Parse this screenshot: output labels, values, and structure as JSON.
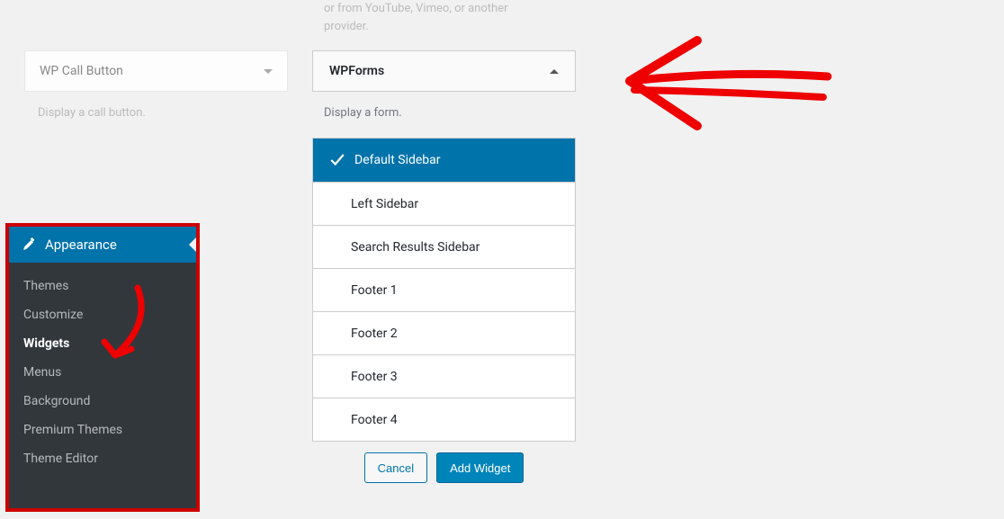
{
  "faded_top": {
    "line1": "or from YouTube, Vimeo, or another",
    "line2": "provider."
  },
  "wp_call": {
    "title": "WP Call Button",
    "desc": "Display a call button."
  },
  "wpforms": {
    "title": "WPForms",
    "desc": "Display a form."
  },
  "areas": [
    {
      "label": "Default Sidebar",
      "selected": true
    },
    {
      "label": "Left Sidebar",
      "selected": false
    },
    {
      "label": "Search Results Sidebar",
      "selected": false
    },
    {
      "label": "Footer 1",
      "selected": false
    },
    {
      "label": "Footer 2",
      "selected": false
    },
    {
      "label": "Footer 3",
      "selected": false
    },
    {
      "label": "Footer 4",
      "selected": false
    }
  ],
  "actions": {
    "cancel": "Cancel",
    "add": "Add Widget"
  },
  "sidemenu": {
    "header": "Appearance",
    "items": [
      {
        "label": "Themes",
        "active": false
      },
      {
        "label": "Customize",
        "active": false
      },
      {
        "label": "Widgets",
        "active": true
      },
      {
        "label": "Menus",
        "active": false
      },
      {
        "label": "Background",
        "active": false
      },
      {
        "label": "Premium Themes",
        "active": false
      },
      {
        "label": "Theme Editor",
        "active": false
      }
    ]
  }
}
